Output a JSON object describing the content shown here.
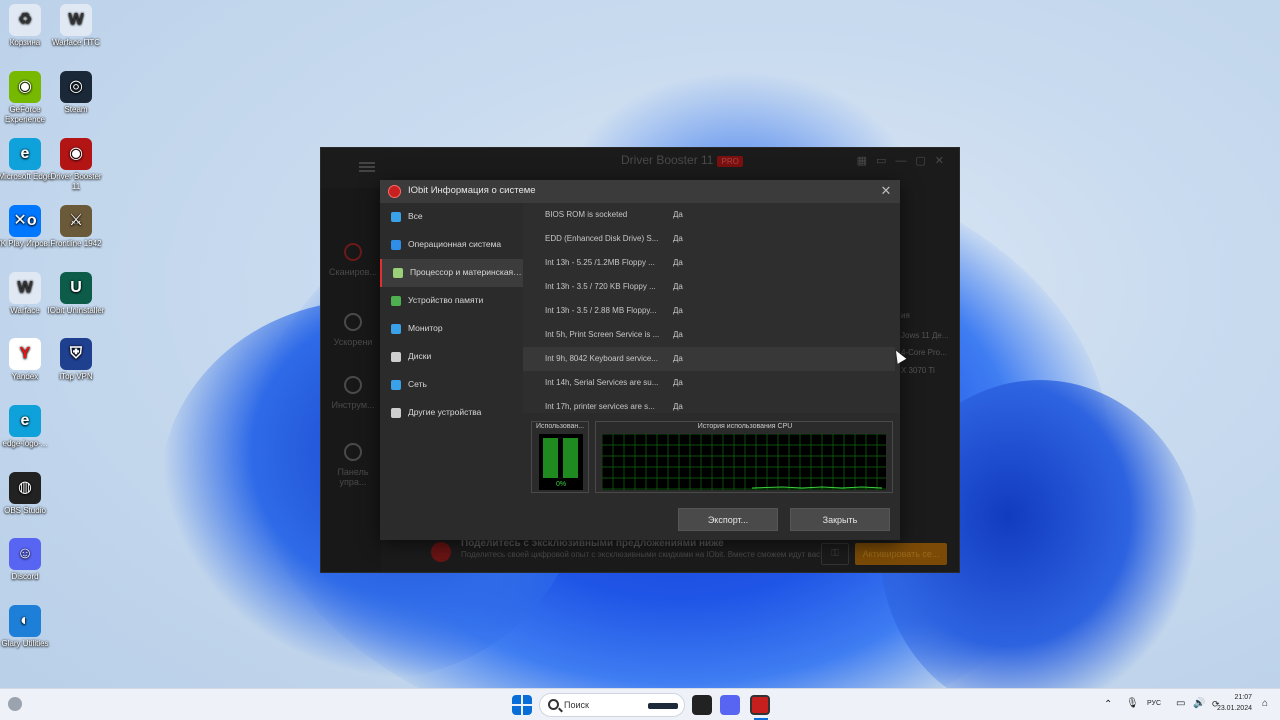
{
  "desktop": {
    "icons": [
      {
        "label": "Корзина",
        "glyph": "♻",
        "color": "#dfe8f3"
      },
      {
        "label": "Warface ПТС",
        "glyph": "W",
        "color": "#dfe8f3"
      },
      {
        "label": "GeForce Experience",
        "glyph": "◉",
        "color": "#76b900"
      },
      {
        "label": "Steam",
        "glyph": "◎",
        "color": "#1b2838"
      },
      {
        "label": "Microsoft Edge",
        "glyph": "e",
        "color": "#0fa1d9"
      },
      {
        "label": "Driver Booster 11",
        "glyph": "◉",
        "color": "#b31515"
      },
      {
        "label": "VK Play Игров...",
        "glyph": "✕o",
        "color": "#0077ff"
      },
      {
        "label": "Frontline 1942",
        "glyph": "⚔",
        "color": "#6b5a3a"
      },
      {
        "label": "Warface",
        "glyph": "W",
        "color": "#dfe8f3"
      },
      {
        "label": "IObit Uninstaller",
        "glyph": "U",
        "color": "#0d5c4a"
      },
      {
        "label": "Yandex",
        "glyph": "Y",
        "color": "#ffffff"
      },
      {
        "label": "iTop VPN",
        "glyph": "⛨",
        "color": "#1f3f8f"
      },
      {
        "label": "edge-logo-...",
        "glyph": "e",
        "color": "#0fa1d9"
      },
      {
        "label": "OBS Studio",
        "glyph": "◍",
        "color": "#222222"
      },
      {
        "label": "Discord",
        "glyph": "☺",
        "color": "#5865f2"
      },
      {
        "label": "Glary Utilities",
        "glyph": "◐",
        "color": "#1d7fd8"
      }
    ]
  },
  "background_window": {
    "title": "Driver Booster 11",
    "badge": "PRO",
    "nav": [
      "Сканиров...",
      "Ускорени",
      "Инструм...",
      "Панель упра..."
    ],
    "right_texts": [
      "ия",
      "Jows 11 Де...",
      "4-Core Pro...",
      "X 3070 Ti"
    ],
    "promo_title": "Поделитесь с эксклюзивными предложениями ниже",
    "promo_text": "Поделитесь своей цифровой опыт с эксклюзивными скидками на IObit. Вместе сможем идут вас!",
    "activate_label": "Активировать се..."
  },
  "dialog": {
    "title": "IObit Информация о системе",
    "close_label": "✕",
    "sidebar": [
      {
        "label": "Все",
        "icon": "layers-icon",
        "color": "#3aa0e8"
      },
      {
        "label": "Операционная система",
        "icon": "windows-icon",
        "color": "#2f8fe8"
      },
      {
        "label": "Процессор и материнская ...",
        "icon": "cpu-icon",
        "color": "#9ad07a",
        "active": true
      },
      {
        "label": "Устройство памяти",
        "icon": "memory-icon",
        "color": "#4fb04f"
      },
      {
        "label": "Монитор",
        "icon": "monitor-icon",
        "color": "#3aa0e8"
      },
      {
        "label": "Диски",
        "icon": "disk-icon",
        "color": "#cfcfcf"
      },
      {
        "label": "Сеть",
        "icon": "network-icon",
        "color": "#3aa0e8"
      },
      {
        "label": "Другие устройства",
        "icon": "usb-icon",
        "color": "#cfcfcf"
      }
    ],
    "rows": [
      {
        "key": "BIOS ROM is socketed",
        "value": "Да"
      },
      {
        "key": "EDD (Enhanced Disk Drive) S...",
        "value": "Да"
      },
      {
        "key": "Int 13h - 5.25 /1.2MB Floppy ...",
        "value": "Да"
      },
      {
        "key": "Int 13h - 3.5 / 720 KB Floppy ...",
        "value": "Да"
      },
      {
        "key": "Int 13h - 3.5 / 2.88 MB Floppy...",
        "value": "Да"
      },
      {
        "key": "Int 5h, Print Screen Service is ...",
        "value": "Да"
      },
      {
        "key": "Int 9h, 8042 Keyboard service...",
        "value": "Да"
      },
      {
        "key": "Int 14h, Serial Services are su...",
        "value": "Да"
      },
      {
        "key": "Int 17h, printer services are s...",
        "value": "Да"
      }
    ],
    "cpu": {
      "usage_label": "Использован...",
      "usage_percent": "0%",
      "history_label": "История использования CPU"
    },
    "export_label": "Экспорт...",
    "close_button_label": "Закрыть"
  },
  "taskbar": {
    "search_placeholder": "Поиск",
    "lang": "РУС",
    "time": "21:07",
    "date": "23.01.2024"
  }
}
